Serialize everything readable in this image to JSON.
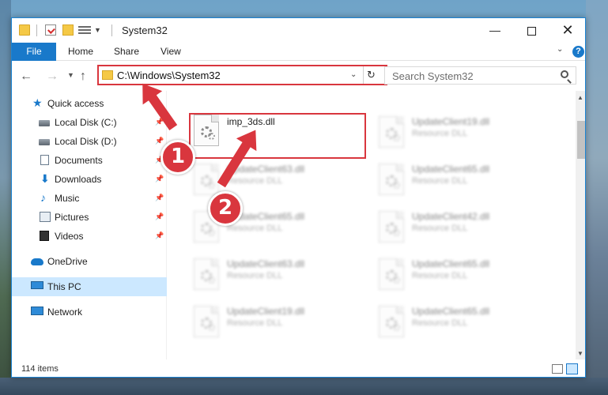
{
  "window": {
    "title": "System32",
    "controls": {
      "minimize": "—",
      "maximize": "",
      "close": "✕"
    }
  },
  "ribbon": {
    "tabs": [
      "File",
      "Home",
      "Share",
      "View"
    ],
    "help": "?"
  },
  "address_bar": {
    "path": "C:\\Windows\\System32"
  },
  "search": {
    "placeholder": "Search System32"
  },
  "sidebar": {
    "items": [
      {
        "label": "Quick access",
        "icon": "star-icon",
        "pinned": false
      },
      {
        "label": "Local Disk (C:)",
        "icon": "drive-icon",
        "pinned": true
      },
      {
        "label": "Local Disk (D:)",
        "icon": "drive-icon",
        "pinned": true
      },
      {
        "label": "Documents",
        "icon": "documents-icon",
        "pinned": true
      },
      {
        "label": "Downloads",
        "icon": "download-icon",
        "pinned": true
      },
      {
        "label": "Music",
        "icon": "music-icon",
        "pinned": true
      },
      {
        "label": "Pictures",
        "icon": "pictures-icon",
        "pinned": true
      },
      {
        "label": "Videos",
        "icon": "videos-icon",
        "pinned": true
      },
      {
        "label": "OneDrive",
        "icon": "onedrive-icon",
        "pinned": false
      },
      {
        "label": "This PC",
        "icon": "computer-icon",
        "pinned": false,
        "selected": true
      },
      {
        "label": "Network",
        "icon": "network-icon",
        "pinned": false
      }
    ]
  },
  "files": {
    "primary": {
      "name": "imp_3ds.dll",
      "type": ""
    },
    "blurred": [
      {
        "name": "UpdateClient19.dll",
        "type": "Resource DLL"
      },
      {
        "name": "UpdateClient63.dll",
        "type": "Resource DLL"
      },
      {
        "name": "UpdateClient65.dll",
        "type": "Resource DLL"
      },
      {
        "name": "UpdateClient65.dll",
        "type": "Resource DLL"
      },
      {
        "name": "UpdateClient42.dll",
        "type": "Resource DLL"
      },
      {
        "name": "UpdateClient63.dll",
        "type": "Resource DLL"
      },
      {
        "name": "UpdateClient65.dll",
        "type": "Resource DLL"
      },
      {
        "name": "UpdateClient19.dll",
        "type": "Resource DLL"
      },
      {
        "name": "UpdateClient65.dll",
        "type": "Resource DLL"
      }
    ]
  },
  "status": {
    "item_count": "114 items"
  },
  "annotations": {
    "step1": "1",
    "step2": "2",
    "color": "#d9363e"
  }
}
